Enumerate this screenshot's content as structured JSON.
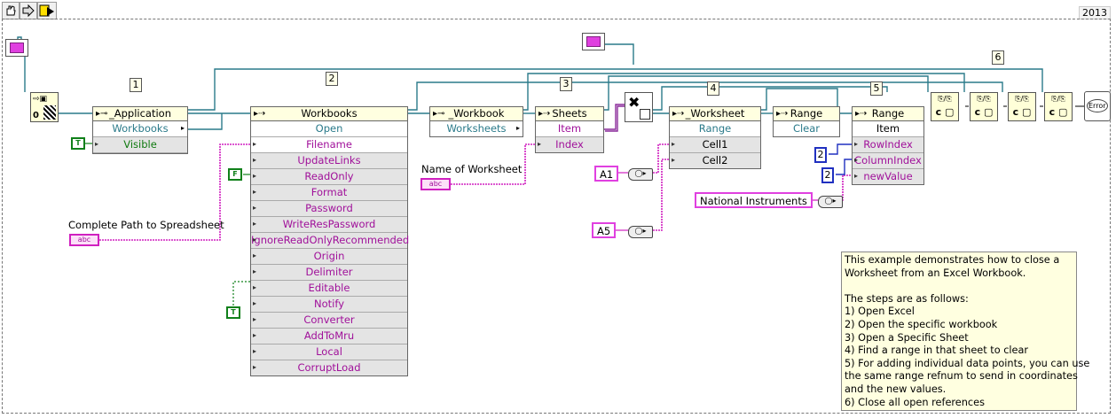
{
  "toolbar": {
    "year": "2013"
  },
  "labels": {
    "n1": "1",
    "n2": "2",
    "n3": "3",
    "n4": "4",
    "n5": "5",
    "n6": "6"
  },
  "application": {
    "header": "_Application",
    "rows": [
      "Workbooks",
      "Visible"
    ]
  },
  "workbooks": {
    "header": "Workbooks",
    "rows": [
      "Open",
      "Filename",
      "UpdateLinks",
      "ReadOnly",
      "Format",
      "Password",
      "WriteResPassword",
      "IgnoreReadOnlyRecommended",
      "Origin",
      "Delimiter",
      "Editable",
      "Notify",
      "Converter",
      "AddToMru",
      "Local",
      "CorruptLoad"
    ]
  },
  "workbook": {
    "header": "_Workbook",
    "rows": [
      "Worksheets"
    ]
  },
  "sheets": {
    "header": "Sheets",
    "rows": [
      "Item",
      "Index"
    ]
  },
  "worksheet": {
    "header": "_Worksheet",
    "rows": [
      "Range",
      "Cell1",
      "Cell2"
    ]
  },
  "range1": {
    "header": "Range",
    "rows": [
      "Clear"
    ]
  },
  "range2": {
    "header": "Range",
    "rows": [
      "Item",
      "RowIndex",
      "ColumnIndex",
      "newValue"
    ]
  },
  "constants": {
    "path_label": "Complete Path to Spreadsheet",
    "sheet_label": "Name of Worksheet",
    "abc": "abc",
    "cell1": "A1",
    "cell2": "A5",
    "row_index": "2",
    "col_index": "2",
    "value": "National Instruments",
    "bool_t": "T",
    "bool_f": "F"
  },
  "close_nodes": {
    "top": "⎘/⎘",
    "bottom": "c ▢"
  },
  "error": {
    "label": "Error"
  },
  "note": {
    "lines": [
      "This example demonstrates how to close a",
      "Worksheet from an Excel Workbook.",
      "",
      "The steps are as follows:",
      "1) Open Excel",
      "2) Open the specific workbook",
      "3) Open a Specific Sheet",
      "4) Find a range in that sheet to clear",
      "5) For adding individual data points, you can use",
      "the same range refnum to send in coordinates",
      "and the new values.",
      "6) Close all open references"
    ]
  },
  "colors": {
    "refnum_wire": "#2a7a8a",
    "string_wire": "#d020c0",
    "bool_wire": "#10801a",
    "number_wire": "#2030c0"
  }
}
